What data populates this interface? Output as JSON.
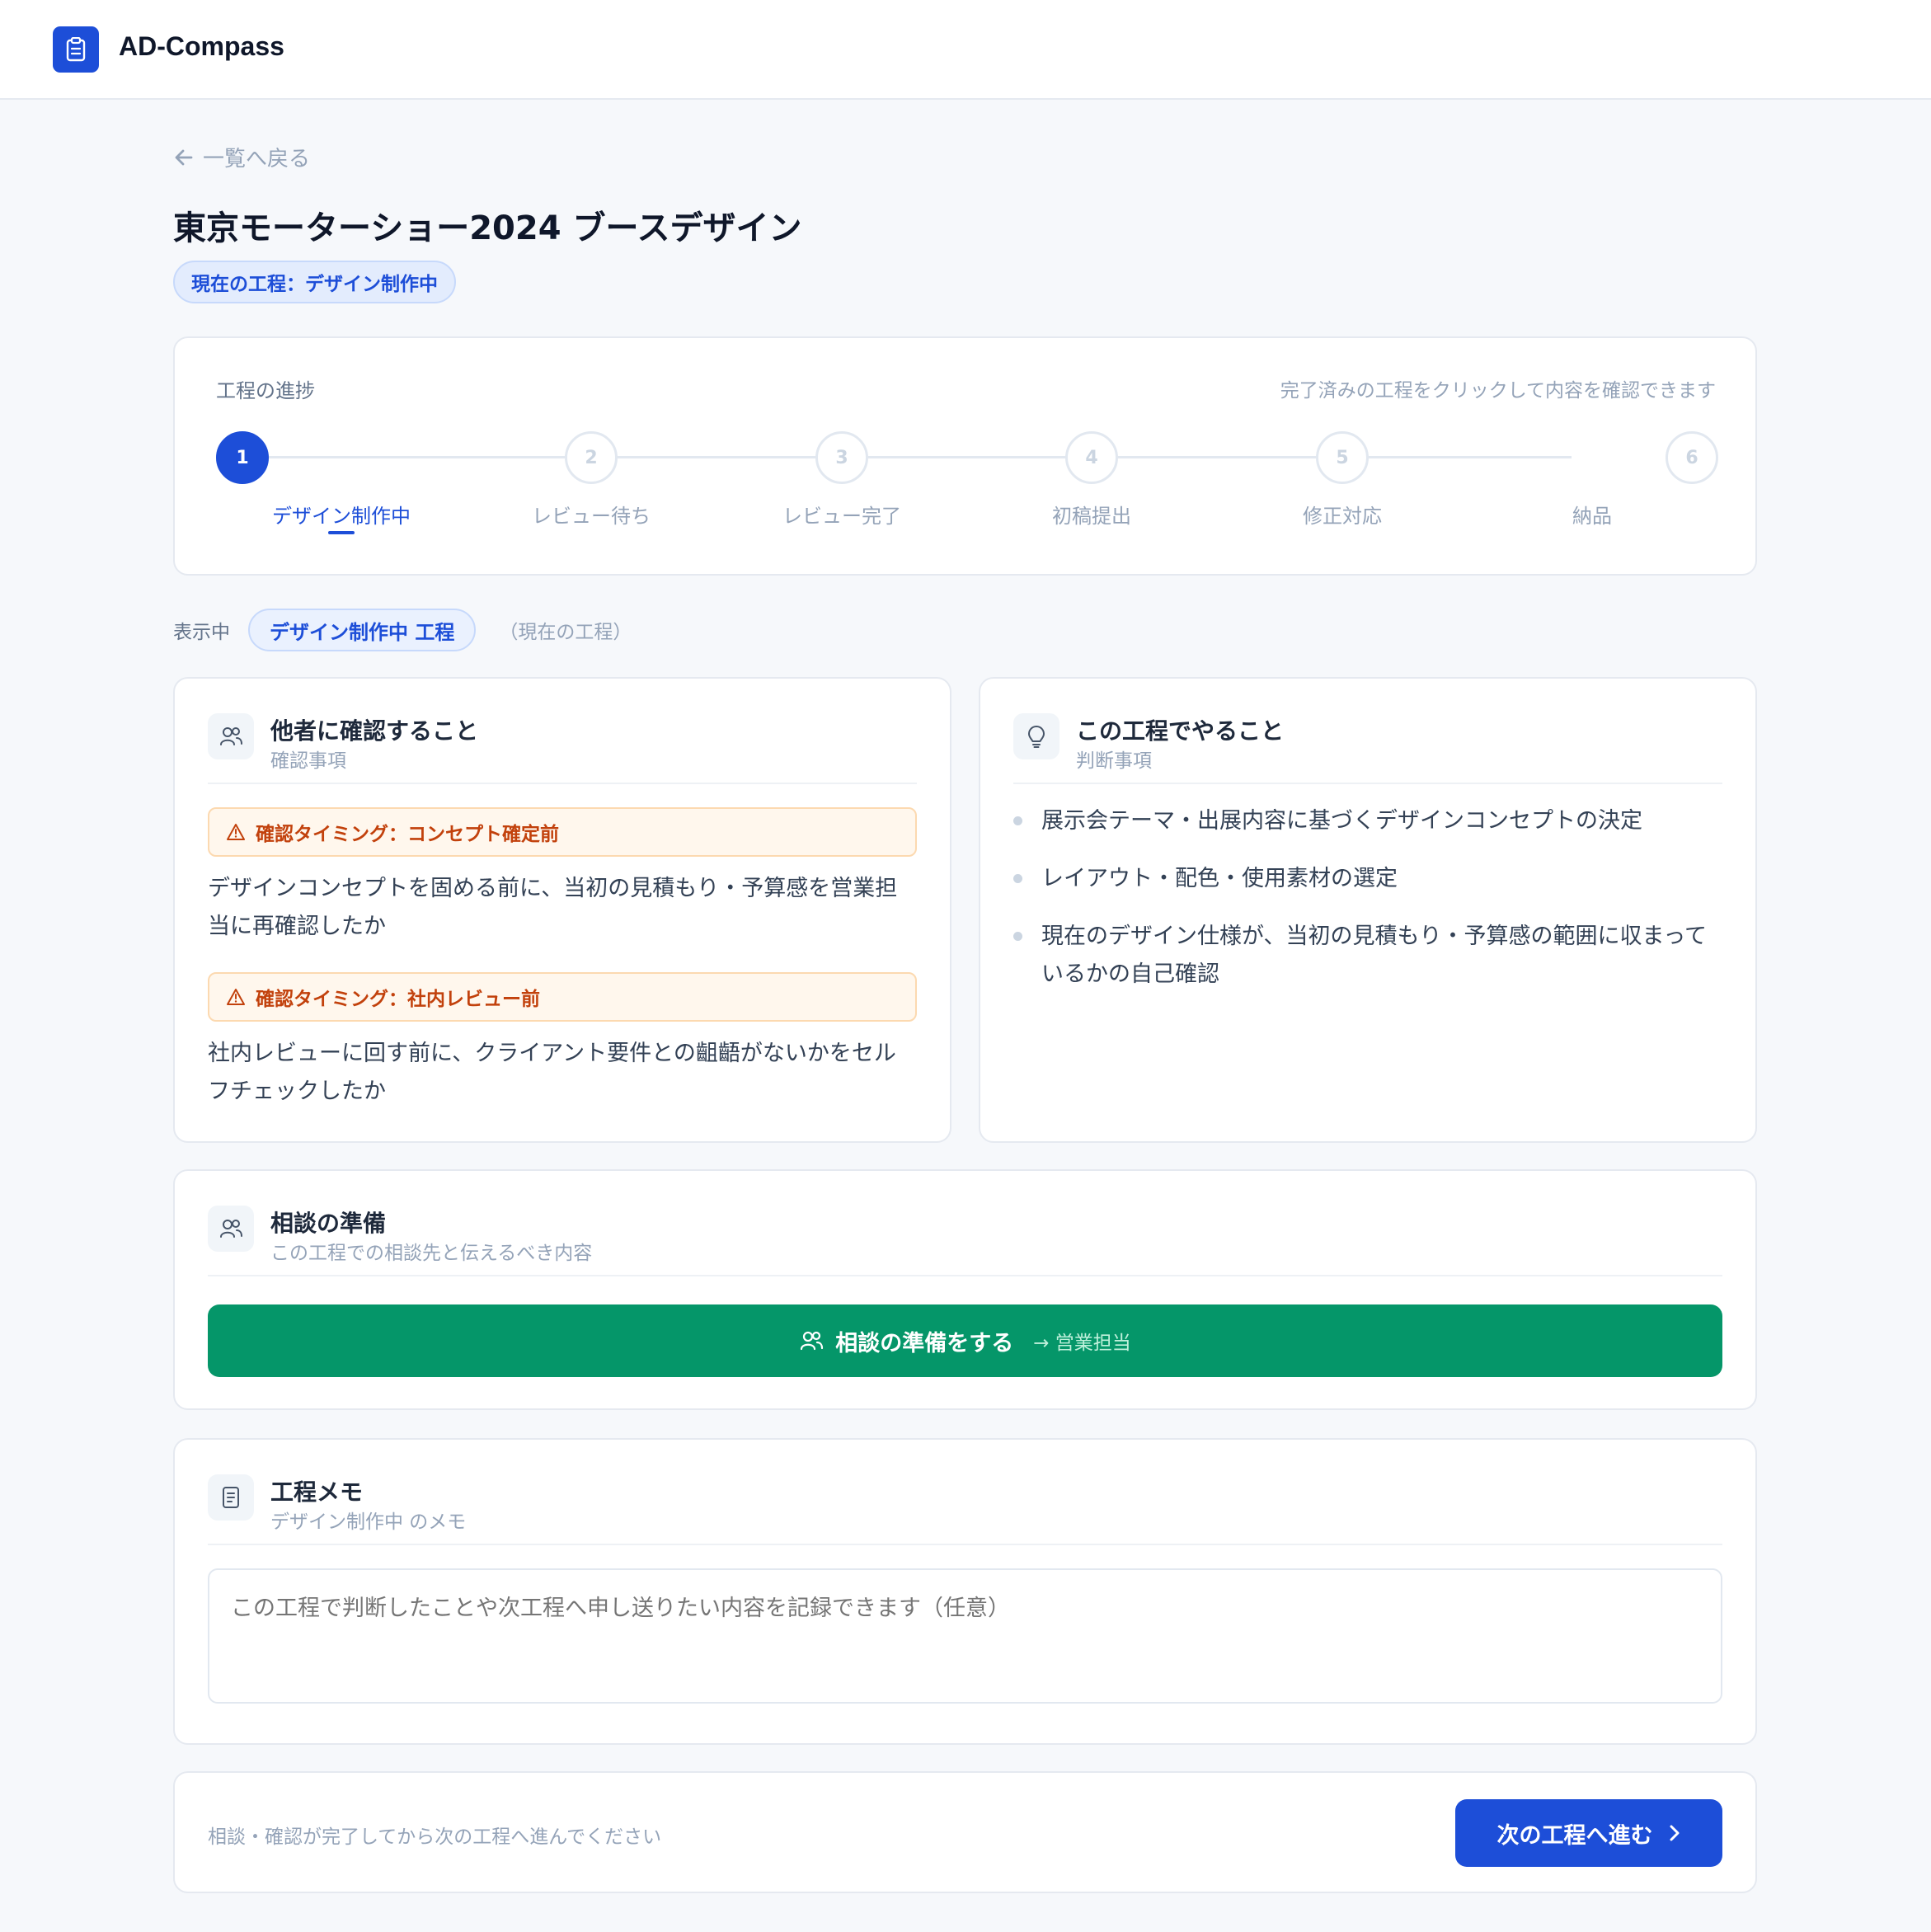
{
  "app": {
    "name": "AD-Compass",
    "logo_icon": "clipboard-icon",
    "accent": "#1d4ed8"
  },
  "nav": {
    "back_label": "一覧へ戻る"
  },
  "project": {
    "title": "東京モーターショー2024 ブースデザイン",
    "current_stage_badge": "現在の工程：デザイン制作中"
  },
  "progress": {
    "title": "工程の進捗",
    "hint": "完了済みの工程をクリックして内容を確認できます",
    "steps": [
      {
        "number": "1",
        "label": "デザイン制作中",
        "state": "active"
      },
      {
        "number": "2",
        "label": "レビュー待ち",
        "state": "upcoming"
      },
      {
        "number": "3",
        "label": "レビュー完了",
        "state": "upcoming"
      },
      {
        "number": "4",
        "label": "初稿提出",
        "state": "upcoming"
      },
      {
        "number": "5",
        "label": "修正対応",
        "state": "upcoming"
      },
      {
        "number": "6",
        "label": "納品",
        "state": "upcoming"
      }
    ]
  },
  "viewing": {
    "label": "表示中",
    "chip": "デザイン制作中 工程",
    "note": "（現在の工程）"
  },
  "confirm": {
    "title": "他者に確認すること",
    "subtitle": "確認事項",
    "items": [
      {
        "timing": "確認タイミング：コンセプト確定前",
        "text": "デザインコンセプトを固める前に、当初の見積もり・予算感を営業担当に再確認したか"
      },
      {
        "timing": "確認タイミング：社内レビュー前",
        "text": "社内レビューに回す前に、クライアント要件との齟齬がないかをセルフチェックしたか"
      }
    ]
  },
  "todo": {
    "title": "この工程でやること",
    "subtitle": "判断事項",
    "items": [
      "展示会テーマ・出展内容に基づくデザインコンセプトの決定",
      "レイアウト・配色・使用素材の選定",
      "現在のデザイン仕様が、当初の見積もり・予算感の範囲に収まっているかの自己確認"
    ]
  },
  "consult": {
    "title": "相談の準備",
    "subtitle": "この工程での相談先と伝えるべき内容",
    "button_label": "相談の準備をする",
    "button_target": "→ 営業担当",
    "button_color": "#059669"
  },
  "memo": {
    "title": "工程メモ",
    "subtitle": "デザイン制作中 のメモ",
    "placeholder": "この工程で判断したことや次工程へ申し送りたい内容を記録できます（任意）",
    "value": ""
  },
  "footer": {
    "note": "相談・確認が完了してから次の工程へ進んでください",
    "next_label": "次の工程へ進む"
  }
}
